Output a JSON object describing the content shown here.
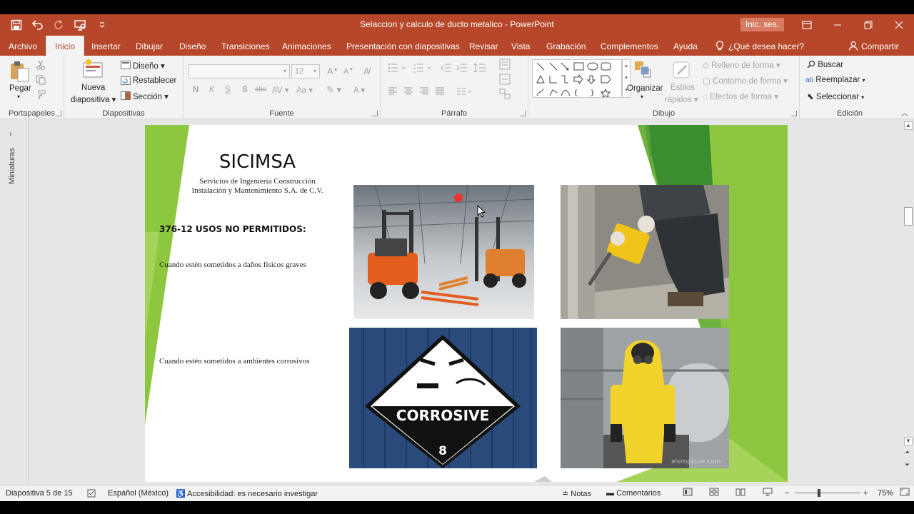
{
  "window": {
    "doc_title": "Selaccion  y calculo de ducto metalico  -  PowerPoint",
    "signin_label": "Inic. ses."
  },
  "tabs": [
    {
      "label": "Archivo"
    },
    {
      "label": "Inicio"
    },
    {
      "label": "Insertar"
    },
    {
      "label": "Dibujar"
    },
    {
      "label": "Diseño"
    },
    {
      "label": "Transiciones"
    },
    {
      "label": "Animaciones"
    },
    {
      "label": "Presentación con diapositivas"
    },
    {
      "label": "Revisar"
    },
    {
      "label": "Vista"
    },
    {
      "label": "Grabación"
    },
    {
      "label": "Complementos"
    },
    {
      "label": "Ayuda"
    }
  ],
  "tell_me": "¿Qué desea hacer?",
  "share_label": "Compartir",
  "ribbon": {
    "clipboard": {
      "paste": "Pegar",
      "group": "Portapapeles"
    },
    "slides": {
      "new_slide_line1": "Nueva",
      "new_slide_line2": "diapositiva",
      "layout": "Diseño",
      "reset": "Restablecer",
      "section": "Sección",
      "group": "Diapositivas"
    },
    "font": {
      "size": "12",
      "bold": "N",
      "italic": "K",
      "underline": "S",
      "shadow": "S",
      "strike": "abc",
      "group": "Fuente"
    },
    "paragraph": {
      "group": "Párrafo"
    },
    "drawing": {
      "arrange_line1": "Organizar",
      "quick_styles_line1": "Estilos",
      "quick_styles_line2": "rápidos",
      "fill": "Relleno de forma",
      "outline": "Contorno de forma",
      "effects": "Efectos de forma",
      "group": "Dibujo"
    },
    "editing": {
      "find": "Buscar",
      "replace": "Reemplazar",
      "select": "Seleccionar",
      "group": "Edición"
    }
  },
  "thumbnails_label": "Miniaturas",
  "slide": {
    "title": "SICIMSA",
    "subtitle_line1": "Servicios de Ingeniería Construcción",
    "subtitle_line2": "Instalación y Mantenimiento S.A. de C.V.",
    "heading": "376-12 USOS NO PERMITIDOS:",
    "text1": "Cuando estén sometidos a daños físicos graves",
    "text2": "Cuando estén sometidos a ambientes corrosivos",
    "sign_text": "CORROSIVE",
    "sign_number": "8",
    "watermark": "elemplode.com"
  },
  "status": {
    "slide_counter": "Diapositiva 5 de 15",
    "language": "Español (México)",
    "accessibility": "Accesibilidad: es necesario investigar",
    "notes": "Notas",
    "comments": "Comentarios",
    "zoom": "75%"
  },
  "colors": {
    "accent": "#b7472a",
    "slide_green": "#8dc63f"
  }
}
